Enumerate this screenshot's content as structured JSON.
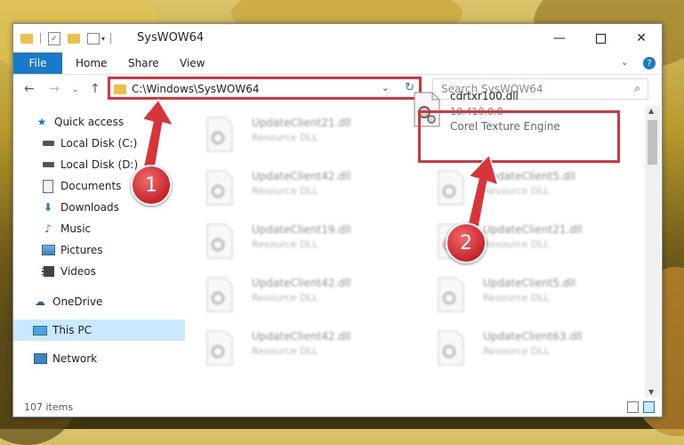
{
  "window": {
    "title": "SysWOW64"
  },
  "ribbon": {
    "tabs": [
      "File",
      "Home",
      "Share",
      "View"
    ]
  },
  "address": {
    "path": "C:\\Windows\\SysWOW64"
  },
  "search": {
    "placeholder": "Search SysWOW64"
  },
  "sidebar": {
    "items": [
      {
        "label": "Quick access",
        "icon": "star-icon"
      },
      {
        "label": "Local Disk (C:)",
        "icon": "drive-icon",
        "pinned": true
      },
      {
        "label": "Local Disk (D:)",
        "icon": "drive-icon",
        "pinned": true
      },
      {
        "label": "Documents",
        "icon": "documents-icon",
        "pinned": true
      },
      {
        "label": "Downloads",
        "icon": "download-icon",
        "pinned": true
      },
      {
        "label": "Music",
        "icon": "music-icon",
        "pinned": true
      },
      {
        "label": "Pictures",
        "icon": "pictures-icon",
        "pinned": true
      },
      {
        "label": "Videos",
        "icon": "videos-icon",
        "pinned": true
      },
      {
        "label": "OneDrive",
        "icon": "cloud-icon"
      },
      {
        "label": "This PC",
        "icon": "computer-icon",
        "selected": true
      },
      {
        "label": "Network",
        "icon": "network-icon"
      }
    ]
  },
  "files": {
    "left": [
      {
        "name": "UpdateClient21.dll",
        "type": "Resource DLL"
      },
      {
        "name": "UpdateClient42.dll",
        "type": "Resource DLL"
      },
      {
        "name": "UpdateClient19.dll",
        "type": "Resource DLL"
      },
      {
        "name": "UpdateClient42.dll",
        "type": "Resource DLL"
      },
      {
        "name": "UpdateClient42.dll",
        "type": "Resource DLL"
      }
    ],
    "right": [
      {
        "name": "UpdateClient5.dll",
        "type": "Resource DLL"
      },
      {
        "name": "UpdateClient21.dll",
        "type": "Resource DLL"
      },
      {
        "name": "UpdateClient5.dll",
        "type": "Resource DLL"
      },
      {
        "name": "UpdateClient63.dll",
        "type": "Resource DLL"
      }
    ],
    "highlighted": {
      "name": "cdrtxr100.dll",
      "version": "10.410.0.0",
      "description": "Corel Texture Engine"
    }
  },
  "status": {
    "count": "107 items"
  },
  "annotations": {
    "step1": "1",
    "step2": "2",
    "color": "#d9343a"
  }
}
